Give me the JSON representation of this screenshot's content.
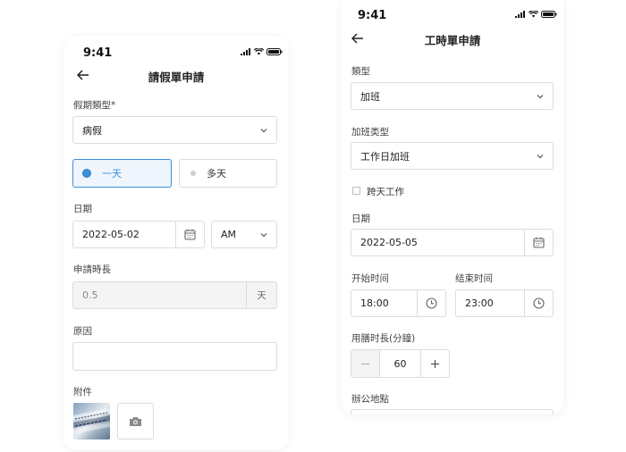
{
  "screen_leave": {
    "status_time": "9:41",
    "title": "請假單申請",
    "leave_type": {
      "label": "假期類型*",
      "value": "病假"
    },
    "duration_options": [
      {
        "label": "一天",
        "selected": true
      },
      {
        "label": "多天",
        "selected": false
      }
    ],
    "date": {
      "label": "日期",
      "value": "2022-05-02",
      "period": "AM"
    },
    "hours": {
      "label": "申請時長",
      "value": "0.5",
      "unit": "天"
    },
    "reason": {
      "label": "原因",
      "value": ""
    },
    "attachment": {
      "label": "附件"
    }
  },
  "screen_timesheet": {
    "status_time": "9:41",
    "title": "工時單申請",
    "type": {
      "label": "類型",
      "value": "加班"
    },
    "ot_type": {
      "label": "加班类型",
      "value": "工作日加班"
    },
    "cross_day": {
      "label": "跨天工作",
      "checked": false
    },
    "date": {
      "label": "日期",
      "value": "2022-05-05"
    },
    "start_time": {
      "label": "开始时间",
      "value": "18:00"
    },
    "end_time": {
      "label": "结束时间",
      "value": "23:00"
    },
    "meal_time": {
      "label": "用膳时長(分鐘)",
      "value": "60"
    },
    "office": {
      "label": "辦公地點"
    }
  },
  "colors": {
    "accent": "#3b8fdb",
    "border": "#dcdcdc",
    "disabled_bg": "#f4f4f4"
  },
  "icons": [
    "back-arrow-icon",
    "signal-icon",
    "wifi-icon",
    "battery-icon",
    "chevron-down-icon",
    "calendar-icon",
    "clock-icon",
    "camera-icon",
    "minus-icon",
    "plus-icon"
  ]
}
